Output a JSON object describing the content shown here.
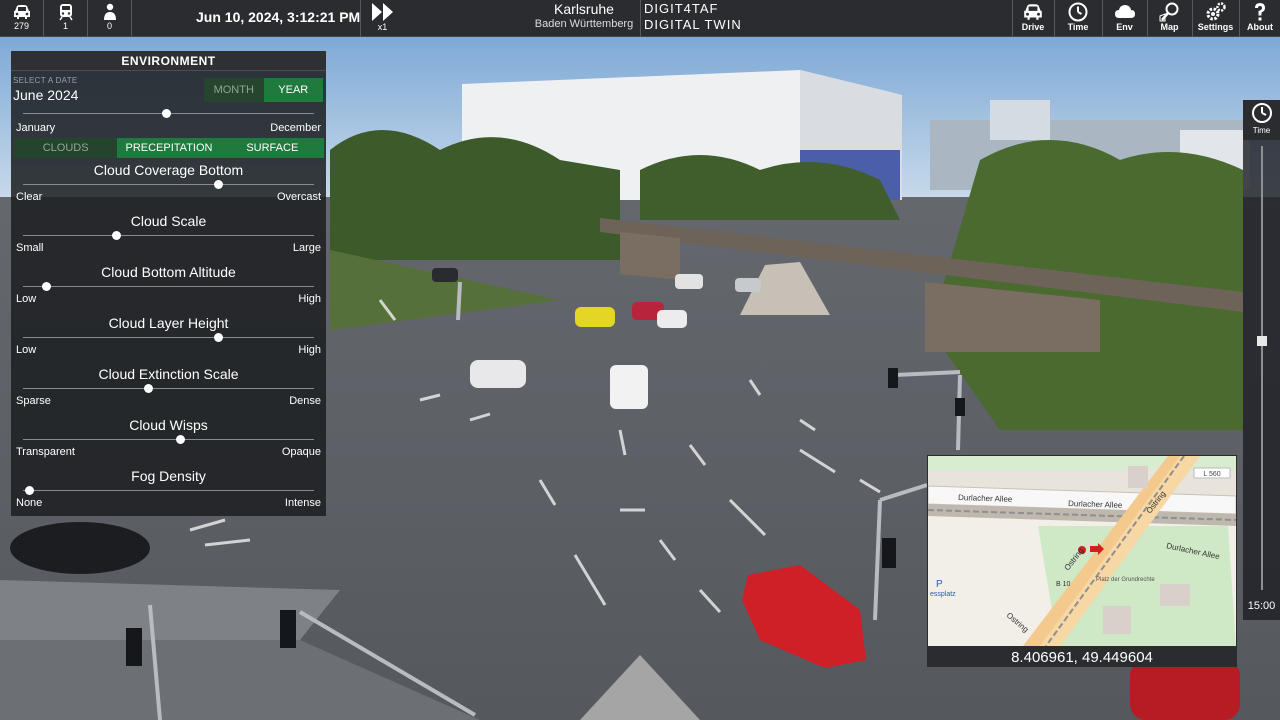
{
  "topbar": {
    "counters": [
      {
        "icon": "car-icon",
        "value": "279"
      },
      {
        "icon": "tram-icon",
        "value": "1"
      },
      {
        "icon": "pedestrian-icon",
        "value": "0"
      }
    ],
    "datetime": "Jun 10, 2024, 3:12:21 PM",
    "speed": "x1",
    "city": "Karlsruhe",
    "region": "Baden Württemberg",
    "brand_line1": "DIGIT4TAF",
    "brand_line2": "DIGITAL TWIN",
    "buttons": [
      {
        "icon": "car-icon",
        "label": "Drive"
      },
      {
        "icon": "clock-icon",
        "label": "Time"
      },
      {
        "icon": "cloud-icon",
        "label": "Env"
      },
      {
        "icon": "map-search-icon",
        "label": "Map"
      },
      {
        "icon": "gears-icon",
        "label": "Settings"
      },
      {
        "icon": "question-icon",
        "label": "About"
      }
    ]
  },
  "environment": {
    "title": "ENVIRONMENT",
    "date_label": "SELECT A DATE",
    "date_value": "June 2024",
    "mode_month": "MONTH",
    "mode_year": "YEAR",
    "mode_selected": "YEAR",
    "date_slider": {
      "min": "January",
      "max": "December",
      "value": 0.49
    },
    "tabs": [
      "CLOUDS",
      "PRECEPITATION",
      "SURFACE"
    ],
    "tab_selected": "PRECEPITATION",
    "sliders": [
      {
        "title": "Cloud Coverage Bottom",
        "min": "Clear",
        "max": "Overcast",
        "value": 0.67
      },
      {
        "title": "Cloud Scale",
        "min": "Small",
        "max": "Large",
        "value": 0.32
      },
      {
        "title": "Cloud Bottom Altitude",
        "min": "Low",
        "max": "High",
        "value": 0.08
      },
      {
        "title": "Cloud Layer Height",
        "min": "Low",
        "max": "High",
        "value": 0.67
      },
      {
        "title": "Cloud Extinction Scale",
        "min": "Sparse",
        "max": "Dense",
        "value": 0.43
      },
      {
        "title": "Cloud Wisps",
        "min": "Transparent",
        "max": "Opaque",
        "value": 0.54
      },
      {
        "title": "Fog Density",
        "min": "None",
        "max": "Intense",
        "value": 0.02
      }
    ]
  },
  "time_slider": {
    "label": "Time",
    "value_text": "15:00",
    "value": 0.44
  },
  "minimap": {
    "coords": "8.406961, 49.449604",
    "labels": {
      "street1": "Durlacher Allee",
      "street2": "Durlacher Allee",
      "street3": "Durlacher Allee",
      "ostring1": "Ostring",
      "ostring2": "Ostring",
      "ostring3": "Ostring",
      "road_b10": "B 10",
      "road_l560": "L 560",
      "place": "Platz der Grundrechte",
      "parking": "P",
      "parking_name": "essplatz"
    }
  }
}
